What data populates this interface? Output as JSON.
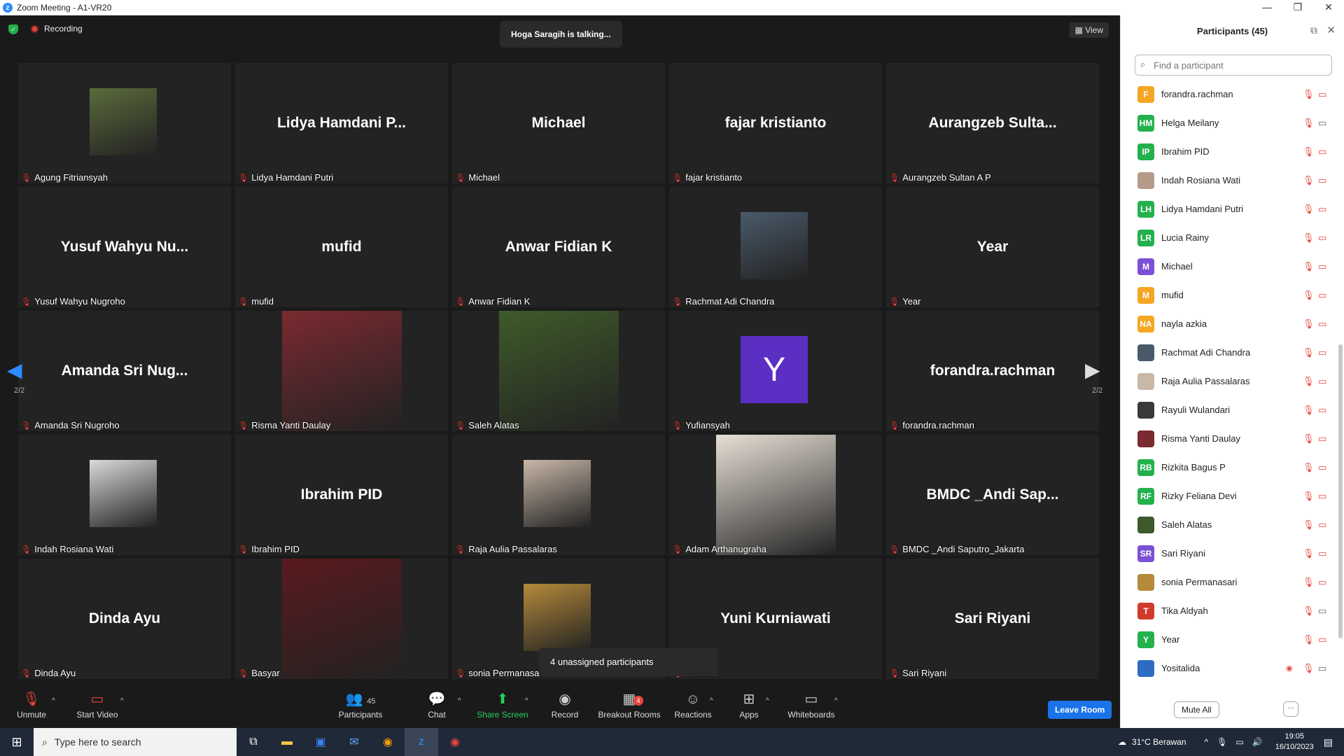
{
  "window": {
    "title": "Zoom Meeting - A1-VR20",
    "minimize": "—",
    "maximize": "❐",
    "close": "✕"
  },
  "top": {
    "recording": "Recording",
    "talking": "Hoga Saragih is talking...",
    "view": "View"
  },
  "tiles": [
    {
      "big": "",
      "label": "Agung Fitriansyah",
      "photo": "#5b6b3c"
    },
    {
      "big": "Lidya  Hamdani  P...",
      "label": "Lidya Hamdani Putri"
    },
    {
      "big": "Michael",
      "label": "Michael"
    },
    {
      "big": "fajar  kristianto",
      "label": "fajar kristianto"
    },
    {
      "big": "Aurangzeb  Sulta...",
      "label": "Aurangzeb Sultan A P"
    },
    {
      "big": "Yusuf  Wahyu  Nu...",
      "label": "Yusuf Wahyu Nugroho"
    },
    {
      "big": "mufid",
      "label": "mufid"
    },
    {
      "big": "Anwar  Fidian  K",
      "label": "Anwar Fidian K"
    },
    {
      "big": "",
      "label": "Rachmat Adi Chandra",
      "photo": "#4a5a6a"
    },
    {
      "big": "Year",
      "label": "Year"
    },
    {
      "big": "Amanda  Sri  Nug...",
      "label": "Amanda Sri Nugroho"
    },
    {
      "big": "",
      "label": "Risma Yanti Daulay",
      "photo": "#7a2a30",
      "tall": true
    },
    {
      "big": "",
      "label": "Saleh Alatas",
      "photo": "#3e5a2a",
      "tall": true
    },
    {
      "big": "",
      "label": "Yufiansyah",
      "avatar": "Y"
    },
    {
      "big": "forandra.rachman",
      "label": "forandra.rachman"
    },
    {
      "big": "",
      "label": "Indah Rosiana Wati",
      "photo": "#d9d9dc"
    },
    {
      "big": "Ibrahim  PID",
      "label": "Ibrahim PID"
    },
    {
      "big": "",
      "label": "Raja Aulia Passalaras",
      "photo": "#c9b8a8"
    },
    {
      "big": "",
      "label": "Adam Arthanugraha",
      "photo": "#e8e0d6",
      "tall": true
    },
    {
      "big": "BMDC  _Andi  Sap...",
      "label": "BMDC _Andi Saputro_Jakarta"
    },
    {
      "big": "Dinda  Ayu",
      "label": "Dinda Ayu"
    },
    {
      "big": "",
      "label": "Basyar",
      "photo": "#5a1a1e",
      "tall": true
    },
    {
      "big": "",
      "label": "sonia Permanasa",
      "photo": "#b58a3a"
    },
    {
      "big": "Yuni  Kurniawati",
      "label": "rniawati"
    },
    {
      "big": "Sari  Riyani",
      "label": "Sari Riyani"
    }
  ],
  "paging": {
    "left": "2/2",
    "right": "2/2"
  },
  "unassigned": "4 unassigned participants",
  "toolbar": {
    "unmute": "Unmute",
    "start_video": "Start Video",
    "participants": "Participants",
    "participants_count": "45",
    "chat": "Chat",
    "share": "Share Screen",
    "record": "Record",
    "breakout": "Breakout Rooms",
    "breakout_badge": "4",
    "reactions": "Reactions",
    "apps": "Apps",
    "whiteboards": "Whiteboards",
    "leave": "Leave Room"
  },
  "panel": {
    "title": "Participants (45)",
    "search_placeholder": "Find a participant",
    "mute_all": "Mute All",
    "more": "···",
    "participants": [
      {
        "initials": "F",
        "color": "#f5a623",
        "name": "forandra.rachman",
        "cam": "off"
      },
      {
        "initials": "HM",
        "color": "#23b14d",
        "name": "Helga Meilany",
        "cam": "on"
      },
      {
        "initials": "IP",
        "color": "#23b14d",
        "name": "Ibrahim PID",
        "cam": "off"
      },
      {
        "initials": "",
        "color": "#b59a8a",
        "name": "Indah Rosiana Wati",
        "cam": "off"
      },
      {
        "initials": "LH",
        "color": "#23b14d",
        "name": "Lidya Hamdani Putri",
        "cam": "off"
      },
      {
        "initials": "LR",
        "color": "#23b14d",
        "name": "Lucia Rainy",
        "cam": "off"
      },
      {
        "initials": "M",
        "color": "#7b4fd6",
        "name": "Michael",
        "cam": "off"
      },
      {
        "initials": "M",
        "color": "#f5a623",
        "name": "mufid",
        "cam": "off"
      },
      {
        "initials": "NA",
        "color": "#f5a623",
        "name": "nayla azkia",
        "cam": "off"
      },
      {
        "initials": "",
        "color": "#4a5a6a",
        "name": "Rachmat Adi Chandra",
        "cam": "off"
      },
      {
        "initials": "",
        "color": "#c9b8a8",
        "name": "Raja Aulia Passalaras",
        "cam": "off"
      },
      {
        "initials": "",
        "color": "#3a3a3a",
        "name": "Rayuli Wulandari",
        "cam": "off"
      },
      {
        "initials": "",
        "color": "#7a2a30",
        "name": "Risma Yanti Daulay",
        "cam": "off"
      },
      {
        "initials": "RB",
        "color": "#23b14d",
        "name": "Rizkita Bagus P",
        "cam": "off"
      },
      {
        "initials": "RF",
        "color": "#23b14d",
        "name": "Rizky Feliana Devi",
        "cam": "off"
      },
      {
        "initials": "",
        "color": "#3e5a2a",
        "name": "Saleh Alatas",
        "cam": "off"
      },
      {
        "initials": "SR",
        "color": "#7b4fd6",
        "name": "Sari Riyani",
        "cam": "off"
      },
      {
        "initials": "",
        "color": "#b58a3a",
        "name": "sonia Permanasari",
        "cam": "off"
      },
      {
        "initials": "T",
        "color": "#d13b2a",
        "name": "Tika Aldyah",
        "cam": "on"
      },
      {
        "initials": "Y",
        "color": "#23b14d",
        "name": "Year",
        "cam": "off"
      },
      {
        "initials": "",
        "color": "#2d6cc0",
        "name": "Yositalida",
        "cam": "on",
        "rec": true
      }
    ]
  },
  "taskbar": {
    "search": "Type here to search",
    "weather": "31°C  Berawan",
    "time": "19:05",
    "date": "16/10/2023"
  }
}
